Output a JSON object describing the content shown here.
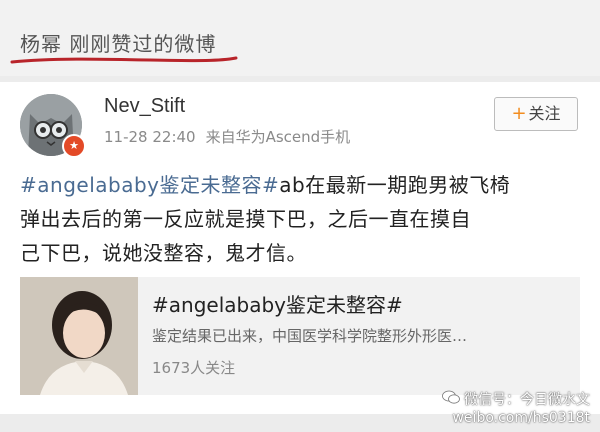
{
  "header": {
    "title": "杨幂 刚刚赞过的微博"
  },
  "post": {
    "username": "Nev_Stift",
    "timestamp": "11-28 22:40",
    "source": "来自华为Ascend手机",
    "follow_label": "关注",
    "follow_plus": "+",
    "text": {
      "hashtag": "#angelababy鉴定未整容#",
      "line1_rest": "ab在最新一期跑男被飞椅",
      "line2": "弹出去后的第一反应就是摸下巴，之后一直在摸自",
      "line3": "己下巴，说她没整容，鬼才信。"
    }
  },
  "topic_card": {
    "title": "#angelababy鉴定未整容#",
    "description": "鉴定结果已出来，中国医学科学院整形外形医…",
    "count": "1673人关注"
  },
  "watermark": {
    "line1": "微信号：今日微水文",
    "line2": "weibo.com/hs0318t"
  },
  "colors": {
    "hashtag": "#4a6b92",
    "underline": "#b8242a",
    "follow_plus": "#f28c1e",
    "vip_badge": "#e34a27"
  }
}
